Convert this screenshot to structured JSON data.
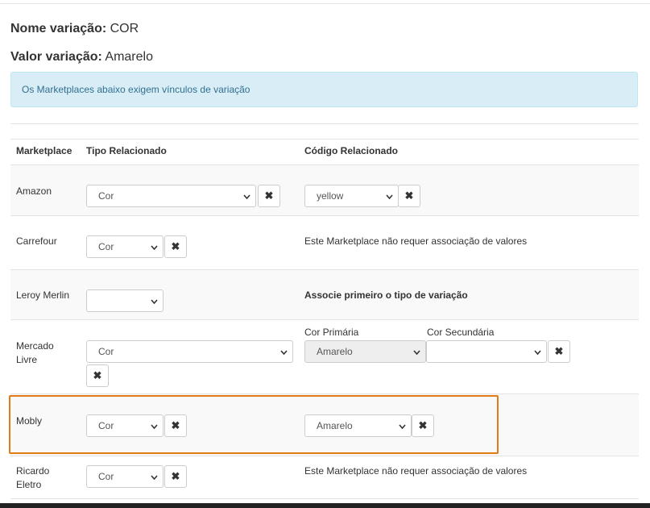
{
  "header": {
    "name_label": "Nome variação:",
    "name_value": "COR",
    "value_label": "Valor variação:",
    "value_value": "Amarelo"
  },
  "alert": {
    "text": "Os Marketplaces abaixo exigem vínculos de variação"
  },
  "table": {
    "columns": [
      "Marketplace",
      "Tipo Relacionado",
      "Código Relacionado"
    ],
    "rows": [
      {
        "marketplace": "Amazon",
        "type": "Cor",
        "code": "yellow"
      },
      {
        "marketplace": "Carrefour",
        "type": "Cor",
        "note": "Este Marketplace não requer associação de valores"
      },
      {
        "marketplace": "Leroy Merlin",
        "type": "",
        "note": "Associe primeiro o tipo de variação"
      },
      {
        "marketplace_line1": "Mercado",
        "marketplace_line2": "Livre",
        "type": "Cor",
        "primary_label": "Cor Primária",
        "primary_value": "Amarelo",
        "secondary_label": "Cor Secundária",
        "secondary_value": ""
      },
      {
        "marketplace": "Mobly",
        "type": "Cor",
        "code": "Amarelo"
      },
      {
        "marketplace_line1": "Ricardo",
        "marketplace_line2": "Eletro",
        "type": "Cor",
        "note": "Este Marketplace não requer associação de valores"
      }
    ]
  },
  "icons": {
    "remove": "✖",
    "chevron": "chevron-down-icon"
  },
  "colors": {
    "highlight": "#e07b15",
    "alert_bg": "#d9edf7",
    "alert_text": "#31708f"
  }
}
